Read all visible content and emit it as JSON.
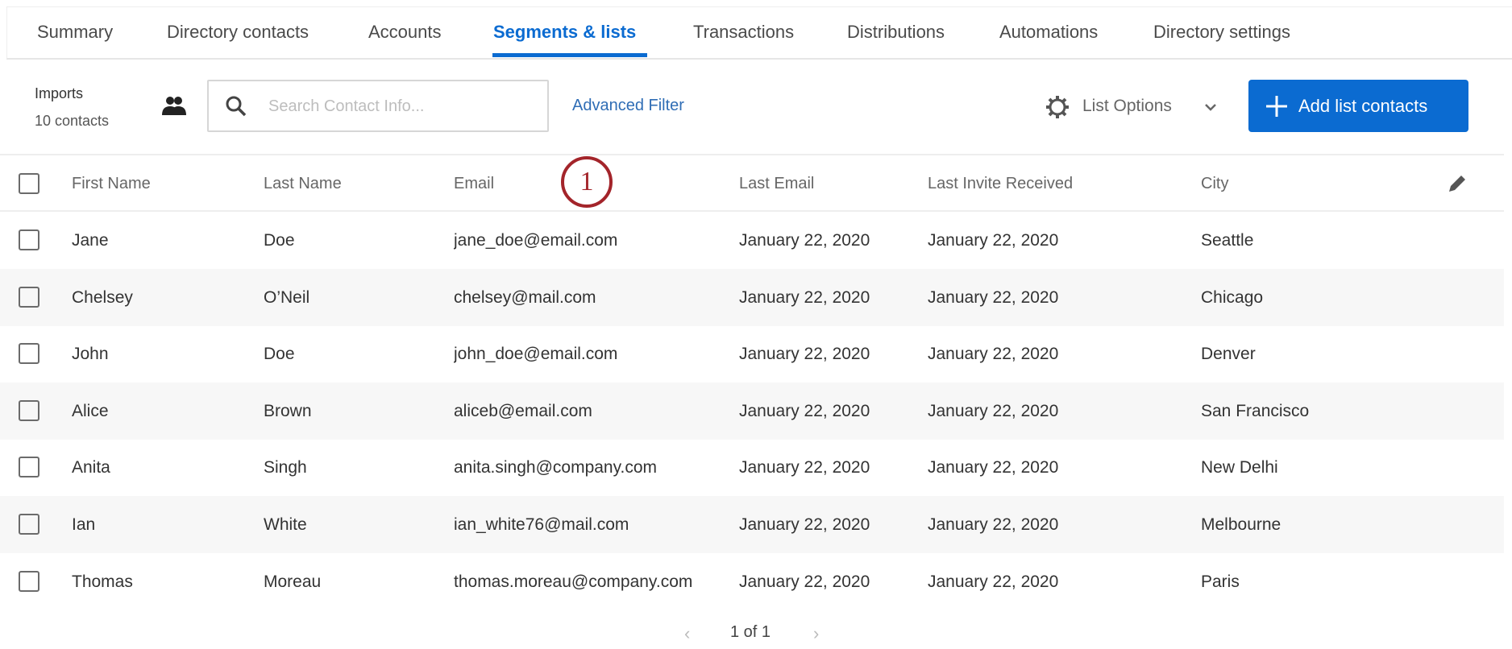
{
  "tabs": [
    "Summary",
    "Directory contacts",
    "Accounts",
    "Segments & lists",
    "Transactions",
    "Distributions",
    "Automations",
    "Directory settings"
  ],
  "active_tab": "Segments & lists",
  "toolbar": {
    "list_name": "Imports",
    "contact_count": "10 contacts",
    "search_placeholder": "Search Contact Info...",
    "advanced_filter": "Advanced Filter",
    "list_options": "List Options",
    "add_button": "Add list contacts"
  },
  "columns": [
    "First Name",
    "Last Name",
    "Email",
    "Last Email",
    "Last Invite Received",
    "City"
  ],
  "annotation": "1",
  "rows": [
    [
      "Jane",
      "Doe",
      "jane_doe@email.com",
      "January 22, 2020",
      "January 22, 2020",
      "Seattle"
    ],
    [
      "Chelsey",
      "O’Neil",
      "chelsey@mail.com",
      "January 22, 2020",
      "January 22, 2020",
      "Chicago"
    ],
    [
      "John",
      "Doe",
      "john_doe@email.com",
      "January 22, 2020",
      "January 22, 2020",
      "Denver"
    ],
    [
      "Alice",
      "Brown",
      "aliceb@email.com",
      "January 22, 2020",
      "January 22, 2020",
      "San Francisco"
    ],
    [
      "Anita",
      "Singh",
      "anita.singh@company.com",
      "January 22, 2020",
      "January 22, 2020",
      "New Delhi"
    ],
    [
      "Ian",
      "White",
      "ian_white76@mail.com",
      "January 22, 2020",
      "January 22, 2020",
      "Melbourne"
    ],
    [
      "Thomas",
      "Moreau",
      "thomas.moreau@company.com",
      "January 22, 2020",
      "January 22, 2020",
      "Paris"
    ]
  ],
  "pagination": {
    "label": "1 of 1"
  },
  "colors": {
    "accent": "#0b6bd1",
    "annotation": "#a3242a",
    "row_alt": "#f7f7f7"
  }
}
